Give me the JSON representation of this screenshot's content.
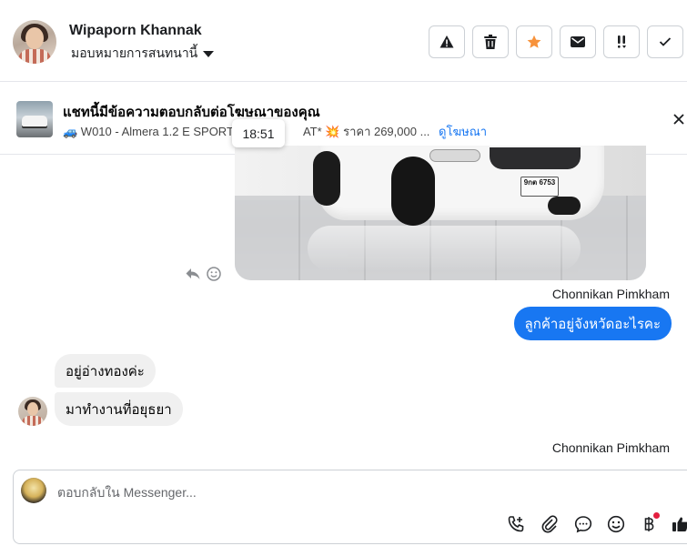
{
  "header": {
    "contact_name": "Wipaporn Khannak",
    "assign_label": "มอบหมายการสนทนานี้",
    "toolbar": [
      {
        "name": "warning-button",
        "icon": "warning-icon"
      },
      {
        "name": "delete-button",
        "icon": "trash-icon"
      },
      {
        "name": "star-button",
        "icon": "star-icon",
        "color": "#f7923b"
      },
      {
        "name": "email-button",
        "icon": "envelope-icon"
      },
      {
        "name": "follow-up-button",
        "icon": "exclamation-icon"
      },
      {
        "name": "done-button",
        "icon": "check-icon"
      }
    ]
  },
  "ad": {
    "title": "แชทนี้มีข้อความตอบกลับต่อโฆษณาของคุณ",
    "subtitle_prefix": "🚙 W010 - Almera 1.2 E SPORTEC",
    "subtitle_middle": "AT* 💥 ราคา 269,000 ...",
    "view_ad_link": "ดูโฆษณา",
    "tooltip_time": "18:51"
  },
  "messages": {
    "car_plate_line1": "9กต 6753",
    "sender_1": "Chonnikan Pimkham",
    "outgoing_1": "ลูกค้าอยู่จังหวัดอะไรคะ",
    "incoming_1": "อยู่อ่างทองค่ะ",
    "incoming_2": "มาทำงานที่อยุธยา",
    "sender_2": "Chonnikan Pimkham"
  },
  "composer": {
    "placeholder": "ตอบกลับใน Messenger..."
  },
  "colors": {
    "accent": "#1877f2",
    "incoming_bubble": "#f0f0f0",
    "star": "#f7923b",
    "notification_dot": "#e41e3f"
  }
}
